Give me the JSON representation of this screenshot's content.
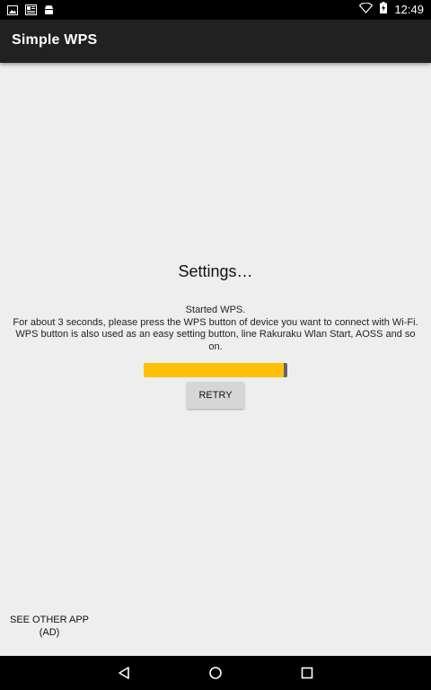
{
  "status_bar": {
    "time": "12:49",
    "left_icons": [
      "image-icon",
      "news-icon",
      "android-icon"
    ],
    "right_icons": [
      "wifi-icon",
      "battery-charging-icon"
    ]
  },
  "app_bar": {
    "title": "Simple WPS"
  },
  "dialog": {
    "title": "Settings…",
    "message_line1": "Started WPS.",
    "message_line2": "For about 3 seconds, please press the WPS button of device you want to connect with Wi-Fi.",
    "message_line3": "WPS button is also used as an easy setting button, line Rakuraku Wlan Start, AOSS and so on.",
    "progress_fraction": 1.0,
    "retry_label": "RETRY"
  },
  "footer": {
    "see_other_app_label": "SEE OTHER APP (AD)"
  },
  "nav_bar": {
    "buttons": [
      "back-icon",
      "home-icon",
      "recents-icon"
    ]
  },
  "colors": {
    "accent": "#ffc107",
    "app_bar": "#212121",
    "background": "#eeeeee"
  }
}
